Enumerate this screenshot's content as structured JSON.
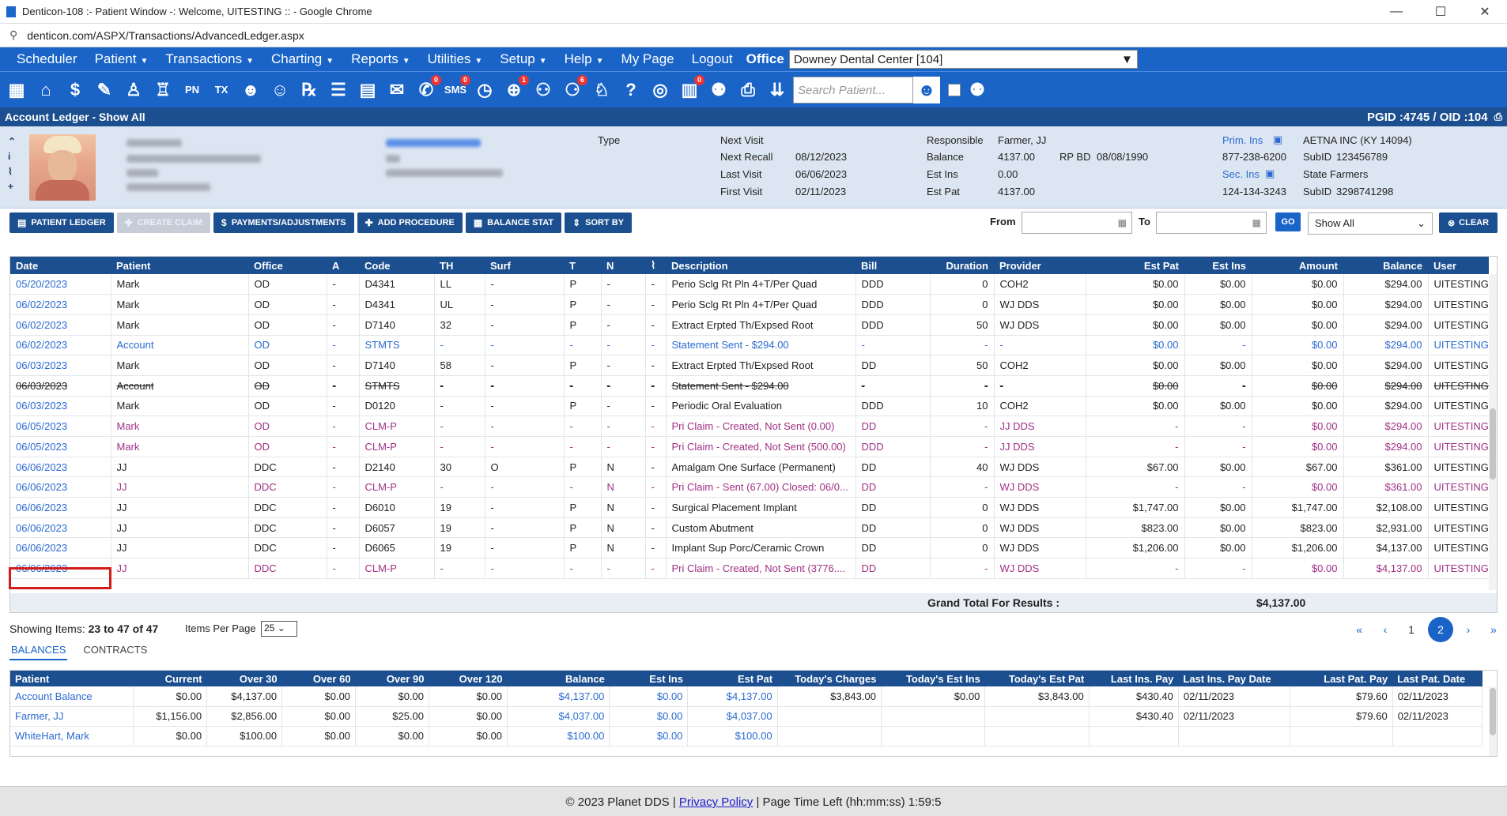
{
  "window": {
    "title": "Denticon-108 :- Patient Window -: Welcome, UITESTING :: - Google Chrome",
    "minimize": "—",
    "maximize": "☐",
    "close": "✕"
  },
  "browser": {
    "url": "denticon.com/ASPX/Transactions/AdvancedLedger.aspx"
  },
  "menu": {
    "items": [
      {
        "label": "Scheduler",
        "caret": ""
      },
      {
        "label": "Patient",
        "caret": "▼"
      },
      {
        "label": "Transactions",
        "caret": "▼"
      },
      {
        "label": "Charting",
        "caret": "▼"
      },
      {
        "label": "Reports",
        "caret": "▼"
      },
      {
        "label": "Utilities",
        "caret": "▼"
      },
      {
        "label": "Setup",
        "caret": "▼"
      },
      {
        "label": "Help",
        "caret": "▼"
      },
      {
        "label": "My Page",
        "caret": ""
      },
      {
        "label": "Logout",
        "caret": ""
      }
    ],
    "office_label": "Office",
    "office_value": "Downey Dental Center [104]"
  },
  "toolbar": {
    "icons": [
      {
        "name": "calendar-icon",
        "glyph": "▦",
        "badge": ""
      },
      {
        "name": "home-icon",
        "glyph": "⌂",
        "badge": ""
      },
      {
        "name": "dollar-icon",
        "glyph": "$",
        "badge": ""
      },
      {
        "name": "pencil-icon",
        "glyph": "✎",
        "badge": ""
      },
      {
        "name": "tooth-chart-icon",
        "glyph": "♙",
        "badge": ""
      },
      {
        "name": "tooth-perio-icon",
        "glyph": "♖",
        "badge": ""
      },
      {
        "name": "pn-icon",
        "glyph": "PN",
        "badge": ""
      },
      {
        "name": "tx-icon",
        "glyph": "TX",
        "badge": ""
      },
      {
        "name": "add-patient-icon",
        "glyph": "☻",
        "badge": ""
      },
      {
        "name": "add-family-icon",
        "glyph": "☺",
        "badge": ""
      },
      {
        "name": "rx-icon",
        "glyph": "℞",
        "badge": ""
      },
      {
        "name": "notes-icon",
        "glyph": "☰",
        "badge": ""
      },
      {
        "name": "document-icon",
        "glyph": "▤",
        "badge": ""
      },
      {
        "name": "mail-icon",
        "glyph": "✉",
        "badge": ""
      },
      {
        "name": "chat-icon",
        "glyph": "✆",
        "badge": "0"
      },
      {
        "name": "sms-icon",
        "glyph": "SMS",
        "badge": "0"
      },
      {
        "name": "clock-icon",
        "glyph": "◷",
        "badge": ""
      },
      {
        "name": "globe-icon",
        "glyph": "⊕",
        "badge": "1"
      },
      {
        "name": "support-icon",
        "glyph": "⚇",
        "badge": ""
      },
      {
        "name": "tasks-icon",
        "glyph": "⚆",
        "badge": "6"
      },
      {
        "name": "tooth-icon",
        "glyph": "♘",
        "badge": ""
      },
      {
        "name": "help-tooth-icon",
        "glyph": "?",
        "badge": ""
      },
      {
        "name": "web-icon",
        "glyph": "◎",
        "badge": ""
      },
      {
        "name": "forms-icon",
        "glyph": "▥",
        "badge": "0"
      },
      {
        "name": "family-icon",
        "glyph": "⚉",
        "badge": ""
      },
      {
        "name": "print-icon",
        "glyph": "⎙",
        "badge": ""
      },
      {
        "name": "download-icon",
        "glyph": "⇊",
        "badge": ""
      }
    ],
    "search_placeholder": "Search Patient..."
  },
  "ledger_header": {
    "title": "Account Ledger - Show All",
    "ids": "PGID :4745 / OID :104"
  },
  "patient_info": {
    "type_label": "Type",
    "visits": [
      {
        "label": "Next Visit",
        "value": ""
      },
      {
        "label": "Next Recall",
        "value": "08/12/2023"
      },
      {
        "label": "Last Visit",
        "value": "06/06/2023"
      },
      {
        "label": "First Visit",
        "value": "02/11/2023"
      }
    ],
    "account": [
      {
        "label": "Responsible",
        "value": "Farmer, JJ"
      },
      {
        "label": "Balance",
        "value": "4137.00"
      },
      {
        "label": "Est Ins",
        "value": "0.00"
      },
      {
        "label": "Est Pat",
        "value": "4137.00"
      }
    ],
    "rp_bd_label": "RP BD",
    "rp_bd_value": "08/08/1990",
    "insurance": {
      "prim_label": "Prim. Ins",
      "prim_name": "AETNA INC (KY 14094)",
      "prim_phone": "877-238-6200",
      "prim_subid_label": "SubID",
      "prim_subid": "123456789",
      "sec_label": "Sec. Ins",
      "sec_name": "State Farmers",
      "sec_phone": "124-134-3243",
      "sec_subid_label": "SubID",
      "sec_subid": "3298741298"
    }
  },
  "actions": {
    "patient_ledger": "PATIENT LEDGER",
    "create_claim": "CREATE CLAIM",
    "payments": "PAYMENTS/ADJUSTMENTS",
    "add_procedure": "ADD PROCEDURE",
    "balance_stat": "BALANCE STAT",
    "sort_by": "SORT BY",
    "from_label": "From",
    "to_label": "To",
    "go": "GO",
    "filter_value": "Show All",
    "clear": "CLEAR"
  },
  "ledger": {
    "columns": [
      "Date",
      "Patient",
      "Office",
      "A",
      "Code",
      "TH",
      "Surf",
      "T",
      "N",
      "",
      "Description",
      "Bill",
      "Duration",
      "Provider",
      "Est Pat",
      "Est Ins",
      "Amount",
      "Balance",
      "User"
    ],
    "rows": [
      {
        "kind": "",
        "cells": [
          "05/20/2023",
          "Mark",
          "OD",
          "-",
          "D4341",
          "LL",
          "-",
          "P",
          "-",
          "-",
          "Perio Sclg Rt Pln 4+T/Per Quad",
          "DDD",
          "0",
          "COH2",
          "$0.00",
          "$0.00",
          "$0.00",
          "$294.00",
          "UITESTING"
        ]
      },
      {
        "kind": "",
        "cells": [
          "06/02/2023",
          "Mark",
          "OD",
          "-",
          "D4341",
          "UL",
          "-",
          "P",
          "-",
          "-",
          "Perio Sclg Rt Pln 4+T/Per Quad",
          "DDD",
          "0",
          "WJ DDS",
          "$0.00",
          "$0.00",
          "$0.00",
          "$294.00",
          "UITESTING"
        ]
      },
      {
        "kind": "",
        "cells": [
          "06/02/2023",
          "Mark",
          "OD",
          "-",
          "D7140",
          "32",
          "-",
          "P",
          "-",
          "-",
          "Extract Erpted Th/Expsed Root",
          "DDD",
          "50",
          "WJ DDS",
          "$0.00",
          "$0.00",
          "$0.00",
          "$294.00",
          "UITESTING"
        ]
      },
      {
        "kind": "stmt",
        "cells": [
          "06/02/2023",
          "Account",
          "OD",
          "-",
          "STMTS",
          "-",
          "-",
          "-",
          "-",
          "-",
          "Statement Sent - $294.00",
          "-",
          "-",
          "-",
          "$0.00",
          "-",
          "$0.00",
          "$294.00",
          "UITESTING"
        ]
      },
      {
        "kind": "",
        "cells": [
          "06/03/2023",
          "Mark",
          "OD",
          "-",
          "D7140",
          "58",
          "-",
          "P",
          "-",
          "-",
          "Extract Erpted Th/Expsed Root",
          "DD",
          "50",
          "COH2",
          "$0.00",
          "$0.00",
          "$0.00",
          "$294.00",
          "UITESTING"
        ]
      },
      {
        "kind": "strike",
        "cells": [
          "06/03/2023",
          "Account",
          "OD",
          "-",
          "STMTS",
          "-",
          "-",
          "-",
          "-",
          "-",
          "Statement Sent - $294.00",
          "-",
          "-",
          "-",
          "$0.00",
          "-",
          "$0.00",
          "$294.00",
          "UITESTING"
        ]
      },
      {
        "kind": "",
        "cells": [
          "06/03/2023",
          "Mark",
          "OD",
          "-",
          "D0120",
          "-",
          "-",
          "P",
          "-",
          "-",
          "Periodic Oral Evaluation",
          "DDD",
          "10",
          "COH2",
          "$0.00",
          "$0.00",
          "$0.00",
          "$294.00",
          "UITESTING"
        ]
      },
      {
        "kind": "claim",
        "cells": [
          "06/05/2023",
          "Mark",
          "OD",
          "-",
          "CLM-P",
          "-",
          "-",
          "-",
          "-",
          "-",
          "Pri Claim - Created, Not Sent (0.00)",
          "DD",
          "-",
          "JJ DDS",
          "-",
          "-",
          "$0.00",
          "$294.00",
          "UITESTING"
        ]
      },
      {
        "kind": "claim",
        "cells": [
          "06/05/2023",
          "Mark",
          "OD",
          "-",
          "CLM-P",
          "-",
          "-",
          "-",
          "-",
          "-",
          "Pri Claim - Created, Not Sent (500.00)",
          "DDD",
          "-",
          "JJ DDS",
          "-",
          "-",
          "$0.00",
          "$294.00",
          "UITESTING"
        ]
      },
      {
        "kind": "",
        "cells": [
          "06/06/2023",
          "JJ",
          "DDC",
          "-",
          "D2140",
          "30",
          "O",
          "P",
          "N",
          "-",
          "Amalgam One Surface (Permanent)",
          "DD",
          "40",
          "WJ DDS",
          "$67.00",
          "$0.00",
          "$67.00",
          "$361.00",
          "UITESTING"
        ]
      },
      {
        "kind": "claim",
        "cells": [
          "06/06/2023",
          "JJ",
          "DDC",
          "-",
          "CLM-P",
          "-",
          "-",
          "-",
          "N",
          "-",
          "Pri Claim - Sent (67.00) Closed: 06/0...",
          "DD",
          "-",
          "WJ DDS",
          "-",
          "-",
          "$0.00",
          "$361.00",
          "UITESTING"
        ]
      },
      {
        "kind": "",
        "cells": [
          "06/06/2023",
          "JJ",
          "DDC",
          "-",
          "D6010",
          "19",
          "-",
          "P",
          "N",
          "-",
          "Surgical Placement Implant",
          "DD",
          "0",
          "WJ DDS",
          "$1,747.00",
          "$0.00",
          "$1,747.00",
          "$2,108.00",
          "UITESTING"
        ]
      },
      {
        "kind": "",
        "cells": [
          "06/06/2023",
          "JJ",
          "DDC",
          "-",
          "D6057",
          "19",
          "-",
          "P",
          "N",
          "-",
          "Custom Abutment",
          "DD",
          "0",
          "WJ DDS",
          "$823.00",
          "$0.00",
          "$823.00",
          "$2,931.00",
          "UITESTING"
        ]
      },
      {
        "kind": "",
        "cells": [
          "06/06/2023",
          "JJ",
          "DDC",
          "-",
          "D6065",
          "19",
          "-",
          "P",
          "N",
          "-",
          "Implant Sup Porc/Ceramic Crown",
          "DD",
          "0",
          "WJ DDS",
          "$1,206.00",
          "$0.00",
          "$1,206.00",
          "$4,137.00",
          "UITESTING"
        ]
      },
      {
        "kind": "claim",
        "cells": [
          "06/06/2023",
          "JJ",
          "DDC",
          "-",
          "CLM-P",
          "-",
          "-",
          "-",
          "-",
          "-",
          "Pri Claim - Created, Not Sent (3776....",
          "DD",
          "-",
          "WJ DDS",
          "-",
          "-",
          "$0.00",
          "$4,137.00",
          "UITESTING"
        ]
      }
    ],
    "grand_total_label": "Grand Total For Results :",
    "grand_total_value": "$4,137.00"
  },
  "pager": {
    "showing_label": "Showing Items:",
    "showing_value": "23 to 47 of 47",
    "per_page_label": "Items Per Page",
    "per_page_value": "25",
    "first": "«",
    "prev": "‹",
    "page1": "1",
    "page2": "2",
    "next": "›",
    "last": "»"
  },
  "tabs": {
    "balances": "BALANCES",
    "contracts": "CONTRACTS"
  },
  "balances": {
    "columns": [
      "Patient",
      "Current",
      "Over 30",
      "Over 60",
      "Over 90",
      "Over 120",
      "Balance",
      "Est Ins",
      "Est Pat",
      "Today's Charges",
      "Today's Est Ins",
      "Today's Est Pat",
      "Last Ins. Pay",
      "Last Ins. Pay Date",
      "Last Pat. Pay",
      "Last Pat. Date"
    ],
    "rows": [
      [
        "Account Balance",
        "$0.00",
        "$4,137.00",
        "$0.00",
        "$0.00",
        "$0.00",
        "$4,137.00",
        "$0.00",
        "$4,137.00",
        "$3,843.00",
        "$0.00",
        "$3,843.00",
        "$430.40",
        "02/11/2023",
        "$79.60",
        "02/11/2023"
      ],
      [
        "Farmer, JJ",
        "$1,156.00",
        "$2,856.00",
        "$0.00",
        "$25.00",
        "$0.00",
        "$4,037.00",
        "$0.00",
        "$4,037.00",
        "",
        "",
        "",
        "$430.40",
        "02/11/2023",
        "$79.60",
        "02/11/2023"
      ],
      [
        "WhiteHart, Mark",
        "$0.00",
        "$100.00",
        "$0.00",
        "$0.00",
        "$0.00",
        "$100.00",
        "$0.00",
        "$100.00",
        "",
        "",
        "",
        "",
        "",
        "",
        ""
      ]
    ]
  },
  "footer": {
    "copyright": "© 2023 Planet DDS |",
    "privacy": "Privacy Policy",
    "time_label": "| Page Time Left (hh:mm:ss) 1:59:5"
  }
}
